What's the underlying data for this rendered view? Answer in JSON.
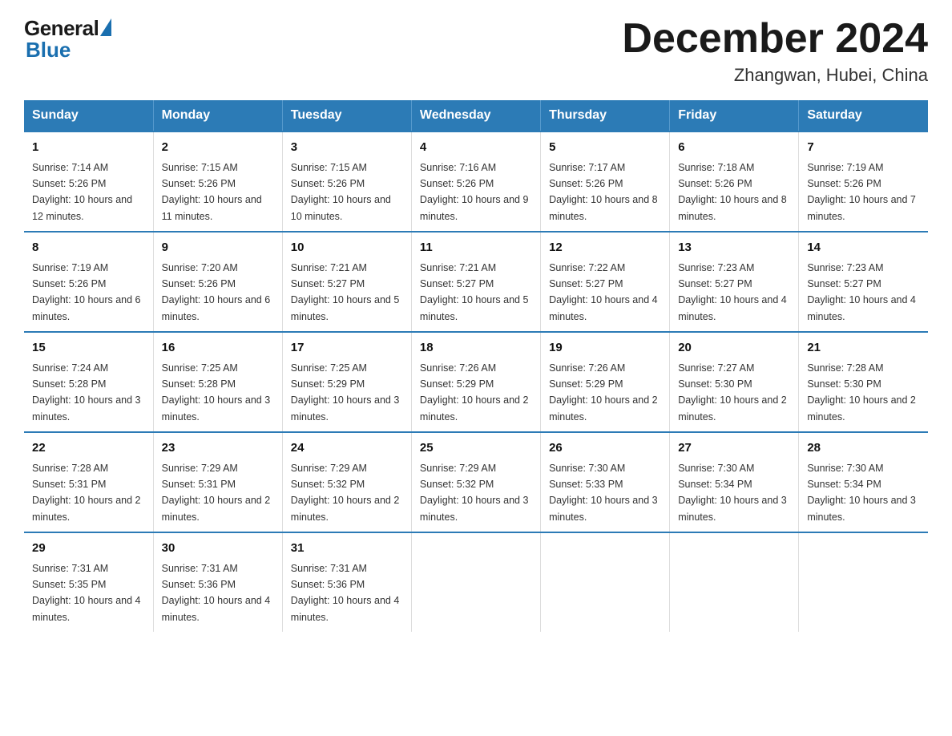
{
  "header": {
    "logo_general": "General",
    "logo_blue": "Blue",
    "month_title": "December 2024",
    "location": "Zhangwan, Hubei, China"
  },
  "days_of_week": [
    "Sunday",
    "Monday",
    "Tuesday",
    "Wednesday",
    "Thursday",
    "Friday",
    "Saturday"
  ],
  "weeks": [
    [
      {
        "day": "1",
        "sunrise": "7:14 AM",
        "sunset": "5:26 PM",
        "daylight": "10 hours and 12 minutes."
      },
      {
        "day": "2",
        "sunrise": "7:15 AM",
        "sunset": "5:26 PM",
        "daylight": "10 hours and 11 minutes."
      },
      {
        "day": "3",
        "sunrise": "7:15 AM",
        "sunset": "5:26 PM",
        "daylight": "10 hours and 10 minutes."
      },
      {
        "day": "4",
        "sunrise": "7:16 AM",
        "sunset": "5:26 PM",
        "daylight": "10 hours and 9 minutes."
      },
      {
        "day": "5",
        "sunrise": "7:17 AM",
        "sunset": "5:26 PM",
        "daylight": "10 hours and 8 minutes."
      },
      {
        "day": "6",
        "sunrise": "7:18 AM",
        "sunset": "5:26 PM",
        "daylight": "10 hours and 8 minutes."
      },
      {
        "day": "7",
        "sunrise": "7:19 AM",
        "sunset": "5:26 PM",
        "daylight": "10 hours and 7 minutes."
      }
    ],
    [
      {
        "day": "8",
        "sunrise": "7:19 AM",
        "sunset": "5:26 PM",
        "daylight": "10 hours and 6 minutes."
      },
      {
        "day": "9",
        "sunrise": "7:20 AM",
        "sunset": "5:26 PM",
        "daylight": "10 hours and 6 minutes."
      },
      {
        "day": "10",
        "sunrise": "7:21 AM",
        "sunset": "5:27 PM",
        "daylight": "10 hours and 5 minutes."
      },
      {
        "day": "11",
        "sunrise": "7:21 AM",
        "sunset": "5:27 PM",
        "daylight": "10 hours and 5 minutes."
      },
      {
        "day": "12",
        "sunrise": "7:22 AM",
        "sunset": "5:27 PM",
        "daylight": "10 hours and 4 minutes."
      },
      {
        "day": "13",
        "sunrise": "7:23 AM",
        "sunset": "5:27 PM",
        "daylight": "10 hours and 4 minutes."
      },
      {
        "day": "14",
        "sunrise": "7:23 AM",
        "sunset": "5:27 PM",
        "daylight": "10 hours and 4 minutes."
      }
    ],
    [
      {
        "day": "15",
        "sunrise": "7:24 AM",
        "sunset": "5:28 PM",
        "daylight": "10 hours and 3 minutes."
      },
      {
        "day": "16",
        "sunrise": "7:25 AM",
        "sunset": "5:28 PM",
        "daylight": "10 hours and 3 minutes."
      },
      {
        "day": "17",
        "sunrise": "7:25 AM",
        "sunset": "5:29 PM",
        "daylight": "10 hours and 3 minutes."
      },
      {
        "day": "18",
        "sunrise": "7:26 AM",
        "sunset": "5:29 PM",
        "daylight": "10 hours and 2 minutes."
      },
      {
        "day": "19",
        "sunrise": "7:26 AM",
        "sunset": "5:29 PM",
        "daylight": "10 hours and 2 minutes."
      },
      {
        "day": "20",
        "sunrise": "7:27 AM",
        "sunset": "5:30 PM",
        "daylight": "10 hours and 2 minutes."
      },
      {
        "day": "21",
        "sunrise": "7:28 AM",
        "sunset": "5:30 PM",
        "daylight": "10 hours and 2 minutes."
      }
    ],
    [
      {
        "day": "22",
        "sunrise": "7:28 AM",
        "sunset": "5:31 PM",
        "daylight": "10 hours and 2 minutes."
      },
      {
        "day": "23",
        "sunrise": "7:29 AM",
        "sunset": "5:31 PM",
        "daylight": "10 hours and 2 minutes."
      },
      {
        "day": "24",
        "sunrise": "7:29 AM",
        "sunset": "5:32 PM",
        "daylight": "10 hours and 2 minutes."
      },
      {
        "day": "25",
        "sunrise": "7:29 AM",
        "sunset": "5:32 PM",
        "daylight": "10 hours and 3 minutes."
      },
      {
        "day": "26",
        "sunrise": "7:30 AM",
        "sunset": "5:33 PM",
        "daylight": "10 hours and 3 minutes."
      },
      {
        "day": "27",
        "sunrise": "7:30 AM",
        "sunset": "5:34 PM",
        "daylight": "10 hours and 3 minutes."
      },
      {
        "day": "28",
        "sunrise": "7:30 AM",
        "sunset": "5:34 PM",
        "daylight": "10 hours and 3 minutes."
      }
    ],
    [
      {
        "day": "29",
        "sunrise": "7:31 AM",
        "sunset": "5:35 PM",
        "daylight": "10 hours and 4 minutes."
      },
      {
        "day": "30",
        "sunrise": "7:31 AM",
        "sunset": "5:36 PM",
        "daylight": "10 hours and 4 minutes."
      },
      {
        "day": "31",
        "sunrise": "7:31 AM",
        "sunset": "5:36 PM",
        "daylight": "10 hours and 4 minutes."
      },
      null,
      null,
      null,
      null
    ]
  ]
}
